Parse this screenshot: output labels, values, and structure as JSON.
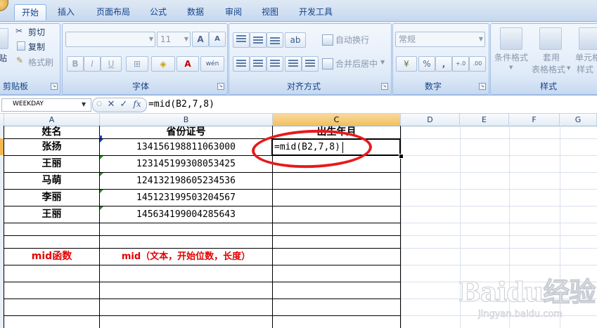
{
  "ribbon": {
    "tabs": [
      "开始",
      "插入",
      "页面布局",
      "公式",
      "数据",
      "审阅",
      "视图",
      "开发工具"
    ],
    "active_tab": "开始",
    "clipboard": {
      "paste_partial": "贴",
      "cut": "剪切",
      "copy": "复制",
      "format_painter": "格式刷",
      "title": "剪贴板"
    },
    "font": {
      "name": "",
      "size": "11",
      "title": "字体",
      "bold": "B",
      "italic": "I",
      "underline": "U",
      "grow": "A",
      "shrink": "A",
      "phonetic": "wén"
    },
    "alignment": {
      "wrap_text": "自动换行",
      "merge_center": "合并后居中",
      "title": "对齐方式"
    },
    "number": {
      "format": "常规",
      "percent": "%",
      "comma": ",",
      "inc_decimal": "+.0",
      "dec_decimal": ".00",
      "title": "数字"
    },
    "styles": {
      "conditional": "条件格式",
      "table_format_line1": "套用",
      "table_format_line2": "表格格式",
      "cell_styles_line1": "单元格",
      "cell_styles_line2": "样式",
      "title": "样式"
    }
  },
  "formula_bar": {
    "name_box": "WEEKDAY",
    "cancel_icon": "✕",
    "enter_icon": "✓",
    "fx": "fx",
    "formula": "=mid(B2,7,8)"
  },
  "grid": {
    "columns": [
      "A",
      "B",
      "C",
      "D",
      "E",
      "F",
      "G"
    ],
    "selected_column": "C",
    "header_row": {
      "a": "姓名",
      "b": "省份证号",
      "c": "出生年月"
    },
    "rows": [
      {
        "name": "张扬",
        "id": "134156198811063000"
      },
      {
        "name": "王丽",
        "id": "123145199308053425"
      },
      {
        "name": "马萌",
        "id": "124132198605234536"
      },
      {
        "name": "李丽",
        "id": "145123199503204567"
      },
      {
        "name": "王丽",
        "id": "145634199004285643"
      }
    ],
    "editing_cell_text": "=mid(B2,7,8)",
    "mid_label": "mid函数",
    "mid_syntax": "mid（文本，开始位数，长度）"
  },
  "watermark": {
    "logo": "Baidu经验",
    "url": "jingyan.baidu.com"
  },
  "colors": {
    "annotation": "#e8191b",
    "selected_header": "#f1c15f",
    "red_text": "#e40000"
  }
}
